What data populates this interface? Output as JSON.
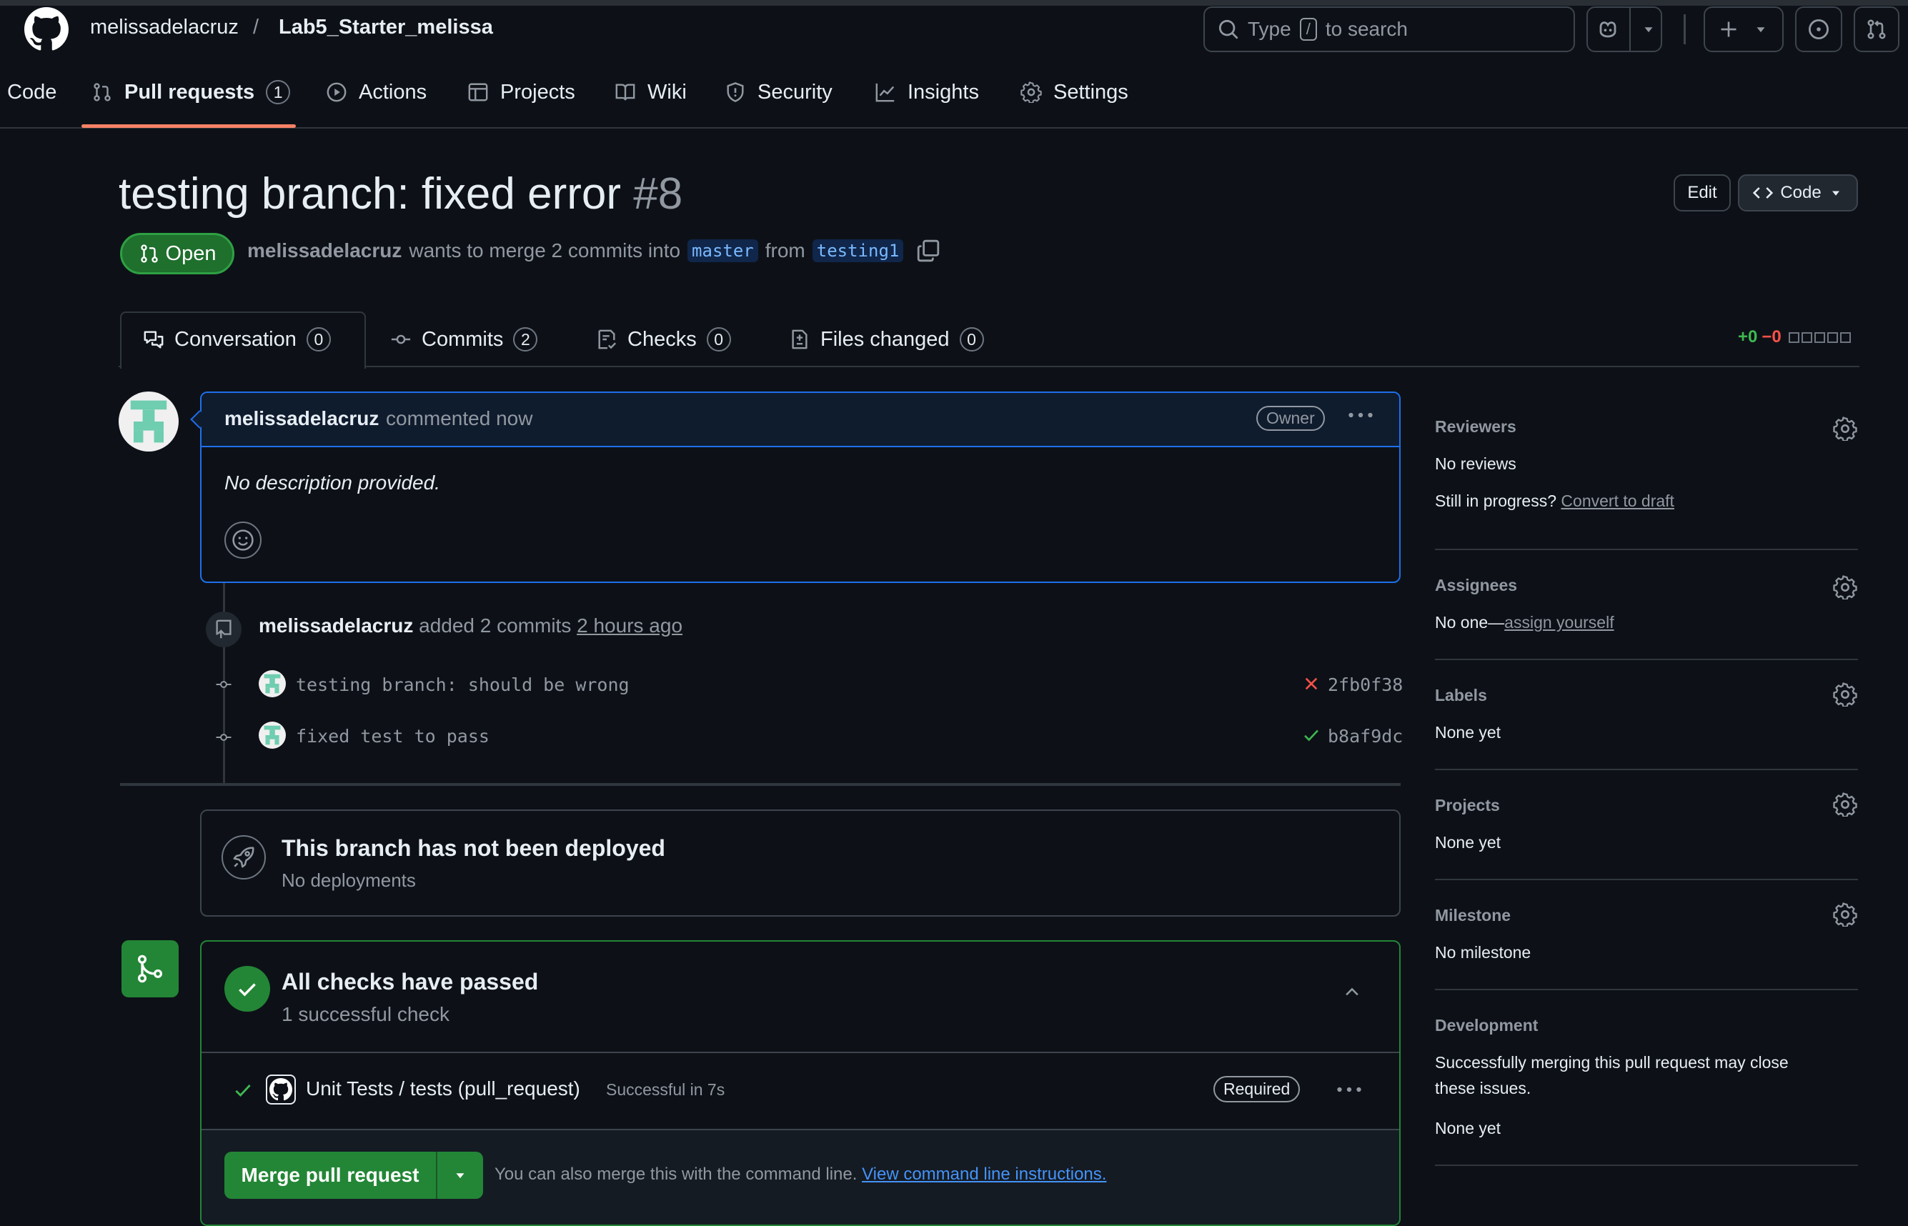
{
  "header": {
    "owner": "melissadelacruz",
    "separator": "/",
    "repo": "Lab5_Starter_melissa",
    "search_prefix": "Type",
    "search_key": "/",
    "search_suffix": "to search"
  },
  "repo_nav": {
    "tabs": [
      {
        "label": "Code"
      },
      {
        "label": "Pull requests",
        "count": "1"
      },
      {
        "label": "Actions"
      },
      {
        "label": "Projects"
      },
      {
        "label": "Wiki"
      },
      {
        "label": "Security"
      },
      {
        "label": "Insights"
      },
      {
        "label": "Settings"
      }
    ]
  },
  "pr": {
    "title": "testing branch: fixed error",
    "number": "#8",
    "edit_label": "Edit",
    "code_label": "Code",
    "state": "Open",
    "author": "melissadelacruz",
    "merge_text_1": "wants to merge 2 commits into",
    "base_branch": "master",
    "merge_text_2": "from",
    "head_branch": "testing1",
    "tabs": [
      {
        "label": "Conversation",
        "count": "0"
      },
      {
        "label": "Commits",
        "count": "2"
      },
      {
        "label": "Checks",
        "count": "0"
      },
      {
        "label": "Files changed",
        "count": "0"
      }
    ],
    "diff_add": "+0",
    "diff_del": "−0",
    "diffstat_boxes": 5
  },
  "comment": {
    "author": "melissadelacruz",
    "time_text": "commented now",
    "role_badge": "Owner",
    "body": "No description provided."
  },
  "timeline": {
    "actor": "melissadelacruz",
    "action_text": "added 2 commits",
    "time": "2 hours ago",
    "commits": [
      {
        "message": "testing branch: should be wrong",
        "sha": "2fb0f38",
        "status": "failure"
      },
      {
        "message": "fixed test to pass",
        "sha": "b8af9dc",
        "status": "success"
      }
    ]
  },
  "deploy": {
    "title": "This branch has not been deployed",
    "subtitle": "No deployments"
  },
  "checks": {
    "title": "All checks have passed",
    "subtitle": "1 successful check",
    "items": [
      {
        "name": "Unit Tests / tests (pull_request)",
        "status_text": "Successful in 7s",
        "badge": "Required"
      }
    ]
  },
  "merge": {
    "button_label": "Merge pull request",
    "info_text": "You can also merge this with the command line.",
    "link_text": "View command line instructions."
  },
  "sidebar": {
    "reviewers": {
      "title": "Reviewers",
      "value": "No reviews",
      "progress_text": "Still in progress?",
      "draft_link": "Convert to draft"
    },
    "assignees": {
      "title": "Assignees",
      "value": "No one—",
      "link": "assign yourself"
    },
    "labels": {
      "title": "Labels",
      "value": "None yet"
    },
    "projects": {
      "title": "Projects",
      "value": "None yet"
    },
    "milestone": {
      "title": "Milestone",
      "value": "No milestone"
    },
    "development": {
      "title": "Development",
      "line1": "Successfully merging this pull request may close",
      "line2": "these issues.",
      "value": "None yet"
    }
  },
  "colors": {
    "background": "#0d1117",
    "border": "#30363d",
    "accent_blue": "#4493f8",
    "success_green": "#238636",
    "success_text": "#3fb950",
    "danger": "#f85149",
    "tab_underline": "#f78166"
  }
}
